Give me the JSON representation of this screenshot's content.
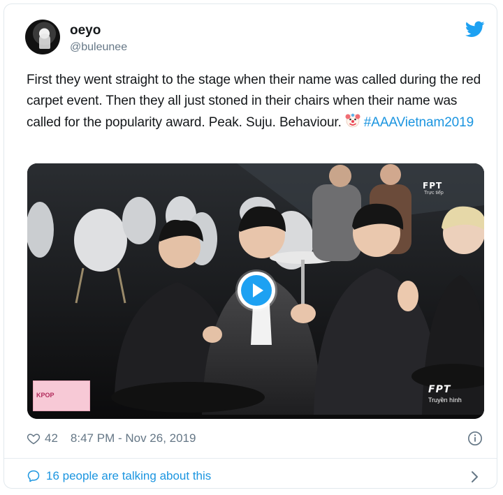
{
  "tweet": {
    "author": {
      "name": "oeyo",
      "handle": "@buleunee",
      "avatar_icon": "avatar-photo"
    },
    "platform_icon": "twitter-bird-icon",
    "text": "First they went straight to the stage when their name was called during the red carpet event. Then they all just stoned in their chairs when their name was called for the popularity award. Peak. Suju. Behaviour.",
    "emoji": "clown-face-emoji",
    "hashtag": "#AAAVietnam2019",
    "video": {
      "play_icon": "play-icon",
      "watermark_top": "FPT",
      "watermark_top_sub": "Trực tiếp",
      "watermark_bottom": "FPT",
      "watermark_bottom_sub": "Truyền hình",
      "corner_logo_text": "KPOP"
    },
    "likes": "42",
    "timestamp": "8:47 PM - Nov 26, 2019",
    "talking": "16 people are talking about this"
  },
  "colors": {
    "text": "#14171a",
    "secondary": "#657786",
    "link": "#1b95e0",
    "twitter_blue": "#1da1f2",
    "border": "#e1e8ed"
  }
}
